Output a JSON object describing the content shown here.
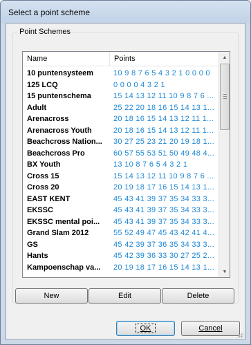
{
  "window": {
    "title": "Select a point scheme"
  },
  "group": {
    "label": "Point Schemes"
  },
  "list": {
    "columns": {
      "name": "Name",
      "points": "Points"
    },
    "rows": [
      {
        "name": "10 puntensysteem",
        "points": "10 9 8 7 6 5 4 3 2 1 0 0 0 0"
      },
      {
        "name": "125 LCQ",
        "points": "0 0 0 0 4 3 2 1"
      },
      {
        "name": "15 puntenschema",
        "points": "15 14 13 12 11 10 9 8 7 6 ..."
      },
      {
        "name": "Adult",
        "points": "25 22 20 18 16 15 14 13 1..."
      },
      {
        "name": "Arenacross",
        "points": "20 18 16 15 14 13 12 11 1..."
      },
      {
        "name": "Arenacross Youth",
        "points": "20 18 16 15 14 13 12 11 1..."
      },
      {
        "name": "Beachcross Nation...",
        "points": "30 27 25 23 21 20 19 18 1..."
      },
      {
        "name": "Beachcross Pro",
        "points": "60 57 55 53 51 50 49 48 4..."
      },
      {
        "name": "BX Youth",
        "points": "13 10 8 7 6 5 4 3 2 1"
      },
      {
        "name": "Cross 15",
        "points": "15 14 13 12 11 10 9 8 7 6 ..."
      },
      {
        "name": "Cross 20",
        "points": "20 19 18 17 16 15 14 13 1..."
      },
      {
        "name": "EAST KENT",
        "points": "45 43 41 39 37 35 34 33 3..."
      },
      {
        "name": "EKSSC",
        "points": "45 43 41 39 37 35 34 33 3..."
      },
      {
        "name": "EKSSC mental poi...",
        "points": "45 43 41 39 37 35 34 33 3..."
      },
      {
        "name": "Grand Slam 2012",
        "points": "55 52 49 47 45 43 42 41 4..."
      },
      {
        "name": "GS",
        "points": "45 42 39 37 36 35 34 33 3..."
      },
      {
        "name": "Hants",
        "points": "45 42 39 36 33 30 27 25 2..."
      },
      {
        "name": "Kampoenschap va...",
        "points": "20 19 18 17 16 15 14 13 1..."
      }
    ]
  },
  "buttons": {
    "new": "New",
    "edit": "Edit",
    "delete": "Delete",
    "ok": "OK",
    "cancel": "Cancel"
  },
  "colors": {
    "points_text": "#1e88d6",
    "window_frame": "#cdd9e8"
  },
  "icons": {
    "scroll_up": "chevron-up-icon",
    "scroll_down": "chevron-down-icon"
  }
}
